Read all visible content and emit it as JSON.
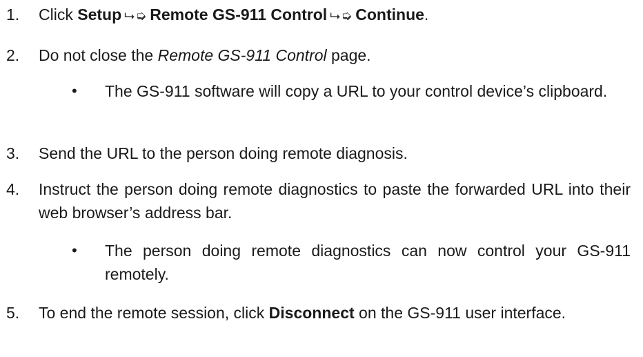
{
  "steps": [
    {
      "number": "1.",
      "prefix": "Click ",
      "bold1": "Setup",
      "arrow1": "⮡➭",
      "bold2": "Remote GS-911 Control",
      "arrow2": "⮡➭",
      "bold3": "Continue",
      "suffix": "."
    },
    {
      "number": "2.",
      "prefix": "Do not close the ",
      "italic": "Remote GS-911 Control",
      "suffix": " page."
    },
    {
      "number": "3.",
      "text": "Send the URL to the person doing remote diagnosis."
    },
    {
      "number": "4.",
      "text": "Instruct the person doing remote diagnostics to paste the forwarded URL into their web browser’s address bar."
    },
    {
      "number": "5.",
      "prefix": "To end the remote session, click ",
      "bold": "Disconnect",
      "suffix": " on the GS-911 user interface."
    }
  ],
  "bullets": [
    {
      "dot": "•",
      "text": "The GS-911 software will copy a URL to your control device’s clipboard."
    },
    {
      "dot": "•",
      "text": "The person doing remote diagnostics can now control your GS-911 remotely."
    }
  ],
  "icons": {
    "menu_arrow": "menu-path-arrow-icon"
  }
}
